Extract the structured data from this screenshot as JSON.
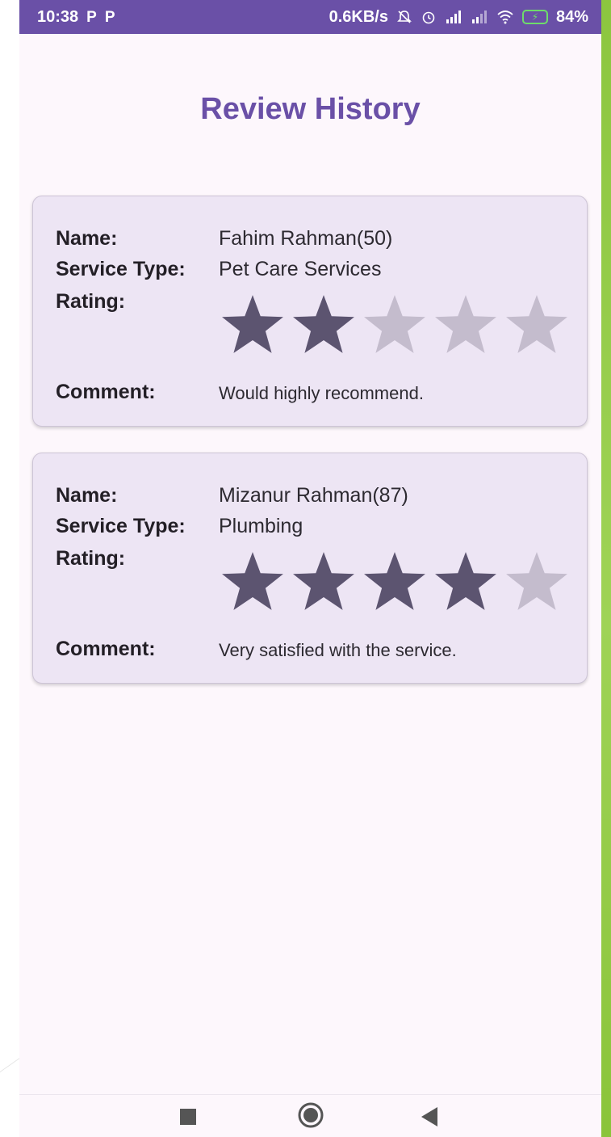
{
  "status_bar": {
    "time": "10:38",
    "left_icons": [
      "P",
      "P"
    ],
    "speed": "0.6KB/s",
    "battery": "84%"
  },
  "title": "Review History",
  "labels": {
    "name": "Name:",
    "service_type": "Service Type:",
    "rating": "Rating:",
    "comment": "Comment:"
  },
  "reviews": [
    {
      "name": "Fahim Rahman(50)",
      "service_type": "Pet Care Services",
      "rating": 2,
      "max_rating": 5,
      "comment": "Would highly recommend."
    },
    {
      "name": "Mizanur Rahman(87)",
      "service_type": "Plumbing",
      "rating": 4,
      "max_rating": 5,
      "comment": "Very satisfied with the service."
    }
  ],
  "colors": {
    "accent": "#6a50a7",
    "star_filled": "#5c5470",
    "star_empty": "#c4bccd"
  }
}
